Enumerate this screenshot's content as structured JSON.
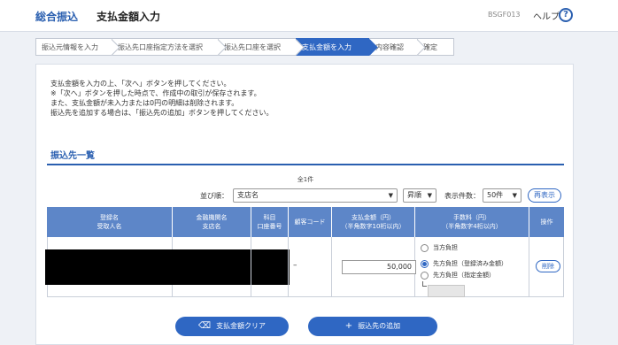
{
  "header": {
    "brand": "総合振込",
    "title": "支払金額入力",
    "screen_id": "BSGF013",
    "help_label": "ヘルプ",
    "help_icon_char": "?"
  },
  "steps": [
    {
      "label": "振込元情報を入力",
      "active": false
    },
    {
      "label": "振込先口座指定方法を選択",
      "active": false
    },
    {
      "label": "振込先口座を選択",
      "active": false
    },
    {
      "label": "支払金額を入力",
      "active": true
    },
    {
      "label": "内容確認",
      "active": false
    },
    {
      "label": "確定",
      "active": false
    }
  ],
  "instructions": [
    "支払金額を入力の上、「次へ」ボタンを押してください。",
    "※「次へ」ボタンを押した時点で、作成中の取引が保存されます。",
    "また、支払金額が未入力または0円の明細は削除されます。",
    "振込先を追加する場合は、「振込先の追加」ボタンを押してください。"
  ],
  "section": {
    "title": "振込先一覧",
    "count": "全1件"
  },
  "controls": {
    "sort_label": "並び順：",
    "sort_value": "支店名",
    "order_value": "昇順",
    "page_size_label": "表示件数：",
    "page_size_value": "50件",
    "redisplay_label": "再表示",
    "caret": "▼"
  },
  "table": {
    "headers": [
      {
        "line1": "登録名",
        "line2": "受取人名"
      },
      {
        "line1": "金融機関名",
        "line2": "支店名"
      },
      {
        "line1": "科目",
        "line2": "口座番号"
      },
      {
        "line1": "顧客コード",
        "line2": ""
      },
      {
        "line1": "支払金額（円）",
        "line2": "（半角数字10桁以内）"
      },
      {
        "line1": "手数料（円）",
        "line2": "（半角数字4桁以内）"
      },
      {
        "line1": "操作",
        "line2": ""
      }
    ],
    "row": {
      "customer_code": "–",
      "amount": "50,000",
      "fee_options": [
        {
          "label": "当方負担",
          "selected": false
        },
        {
          "label": "先方負担（登録済み金額）",
          "selected": true
        },
        {
          "label": "先方負担（指定金額）",
          "selected": false
        }
      ],
      "fee_amount": "",
      "delete_label": "削除"
    }
  },
  "buttons": {
    "clear_label": "支払金額クリア",
    "clear_icon": "eraser-icon",
    "add_label": "振込先の追加",
    "add_icon": "plus-icon"
  },
  "colors": {
    "accent": "#2f67c3",
    "table_header": "#5d86c8"
  }
}
